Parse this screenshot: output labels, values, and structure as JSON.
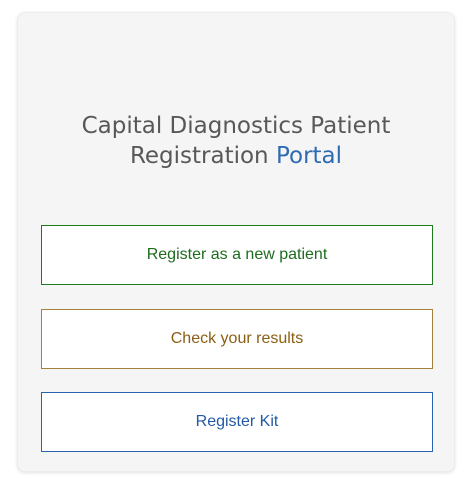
{
  "card": {
    "title_main": "Capital Diagnostics Patient Registration",
    "title_accent": "Portal",
    "accent_color": "#2f6bb3"
  },
  "actions": {
    "register_new_patient": "Register as a new patient",
    "check_results": "Check your results",
    "register_kit": "Register Kit"
  },
  "colors": {
    "register_button": "#1e7b1e",
    "results_button": "#a57f3b",
    "kit_button": "#2a62ad"
  }
}
